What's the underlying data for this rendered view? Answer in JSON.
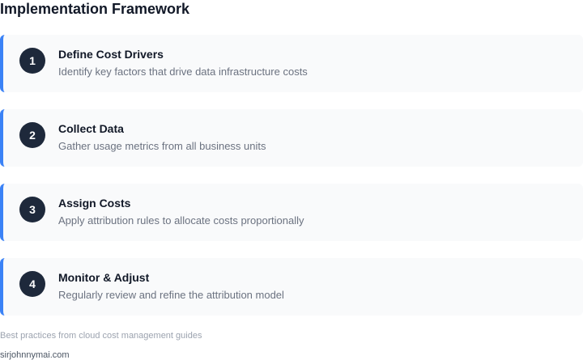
{
  "page": {
    "title": "Implementation Framework",
    "footnote": "Best practices from cloud cost management guides",
    "site": "sirjohnnymai.com"
  },
  "steps": [
    {
      "number": "1",
      "title": "Define Cost Drivers",
      "description": "Identify key factors that drive data infrastructure costs"
    },
    {
      "number": "2",
      "title": "Collect Data",
      "description": "Gather usage metrics from all business units"
    },
    {
      "number": "3",
      "title": "Assign Costs",
      "description": "Apply attribution rules to allocate costs proportionally"
    },
    {
      "number": "4",
      "title": "Monitor & Adjust",
      "description": "Regularly review and refine the attribution model"
    }
  ],
  "colors": {
    "accent": "#3b82f6",
    "badge": "#1e293b",
    "card_background": "#f9fafb"
  }
}
